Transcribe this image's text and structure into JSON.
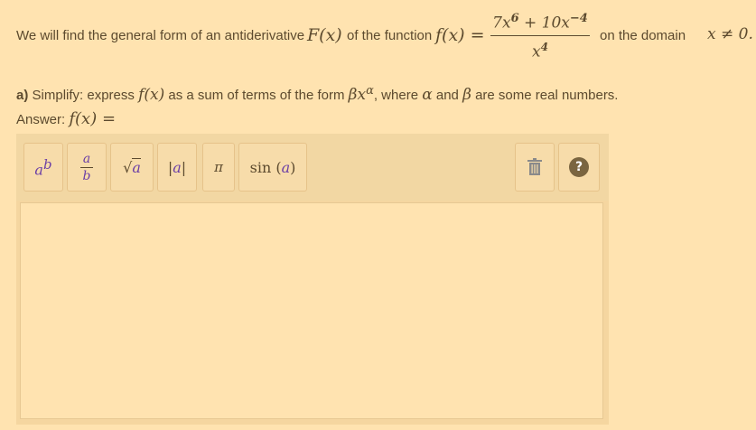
{
  "problem": {
    "intro": "We will find the general form of an antiderivative",
    "F_symbol": "F(x)",
    "of_function": "of the function",
    "f_lhs": "f(x) =",
    "numer_a": "7x",
    "numer_a_exp": "6",
    "numer_plus": " + 10x",
    "numer_b_exp": "−4",
    "denom_base": "x",
    "denom_exp": "4",
    "domain_text": "on the domain",
    "domain_math": "x ≠ 0."
  },
  "partA": {
    "label": "a)",
    "instr1": "Simplify:  express",
    "fx": "f(x)",
    "instr2": "as a sum of terms of the form",
    "form_base": "βx",
    "form_exp": "α",
    "instr3": ", where",
    "alpha": "α",
    "and": "and",
    "beta": "β",
    "instr4": "are some real numbers."
  },
  "answer": {
    "label": "Answer:",
    "fx": "f(x) ="
  },
  "toolbar": {
    "pow_base": "a",
    "pow_exp": "b",
    "frac_num": "a",
    "frac_den": "b",
    "sqrt_sym": "√",
    "sqrt_var": "a",
    "abs_left": "|",
    "abs_var": "a",
    "abs_right": "|",
    "pi": "π",
    "sin_fn": "sin",
    "sin_open": "(",
    "sin_var": "a",
    "sin_close": ")",
    "help": "?",
    "icons": {
      "power": "power-icon",
      "fraction": "fraction-icon",
      "sqrt": "sqrt-icon",
      "abs": "abs-icon",
      "pi": "pi-icon",
      "sin": "sin-icon",
      "trash": "trash-icon",
      "help": "help-icon"
    }
  },
  "colors": {
    "background": "#ffe3b0",
    "text": "#5c4a2e",
    "toolbar": "#f2d7a3",
    "variable": "#6b3fa6"
  }
}
